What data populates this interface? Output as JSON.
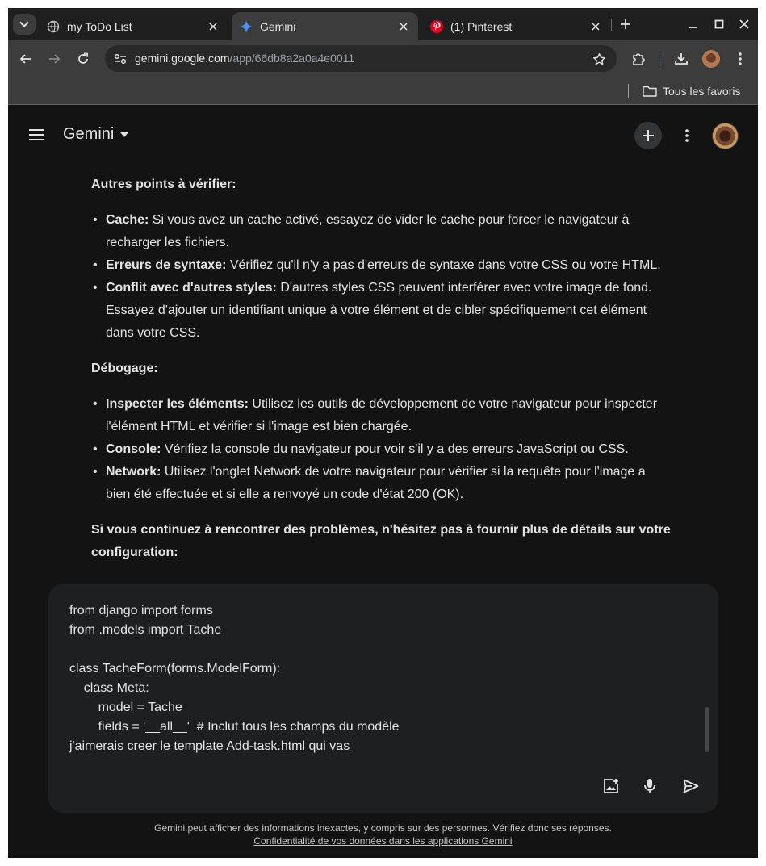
{
  "browser": {
    "tabs": [
      {
        "title": "my ToDo List",
        "favicon": "globe-icon",
        "active": false
      },
      {
        "title": "Gemini",
        "favicon": "gemini-spark-icon",
        "active": true
      },
      {
        "title": "(1) Pinterest",
        "favicon": "pinterest-icon",
        "active": false
      }
    ],
    "url_host": "gemini.google.com",
    "url_path": "/app/66db8a2a0a4e0011",
    "bookmark_folder": "Tous les favoris"
  },
  "gemini": {
    "title": "Gemini",
    "colors": {
      "background": "#131314",
      "input": "#1e1f20",
      "text": "#e3e3e3",
      "accent": "#4c8df6"
    }
  },
  "response": {
    "section1_heading": "Autres points à vérifier:",
    "section1_items": [
      {
        "term": "Cache:",
        "text": " Si vous avez un cache activé, essayez de vider le cache pour forcer le navigateur à recharger les fichiers."
      },
      {
        "term": "Erreurs de syntaxe:",
        "text": " Vérifiez qu'il n'y a pas d'erreurs de syntaxe dans votre CSS ou votre HTML."
      },
      {
        "term": "Conflit avec d'autres styles:",
        "text": " D'autres styles CSS peuvent interférer avec votre image de fond. Essayez d'ajouter un identifiant unique à votre élément et de cibler spécifiquement cet élément dans votre CSS."
      }
    ],
    "section2_heading": "Débogage:",
    "section2_items": [
      {
        "term": "Inspecter les éléments:",
        "text": " Utilisez les outils de développement de votre navigateur pour inspecter l'élément HTML et vérifier si l'image est bien chargée."
      },
      {
        "term": "Console:",
        "text": " Vérifiez la console du navigateur pour voir s'il y a des erreurs JavaScript ou CSS."
      },
      {
        "term": "Network:",
        "text": " Utilisez l'onglet Network de votre navigateur pour vérifier si la requête pour l'image a bien été effectuée et si elle a renvoyé un code d'état 200 (OK)."
      }
    ],
    "closing": "Si vous continuez à rencontrer des problèmes, n'hésitez pas à fournir plus de détails sur votre configuration:"
  },
  "prompt": {
    "lines": [
      "from django import forms",
      "from .models import Tache",
      "",
      "class TacheForm(forms.ModelForm):",
      "    class Meta:",
      "        model = Tache",
      "        fields = '__all__'  # Inclut tous les champs du modèle",
      "j'aimerais creer le template Add-task.html qui vas"
    ]
  },
  "footer": {
    "disclaimer": "Gemini peut afficher des informations inexactes, y compris sur des personnes. Vérifiez donc ses réponses.",
    "privacy_link": "Confidentialité de vos données dans les applications Gemini"
  }
}
